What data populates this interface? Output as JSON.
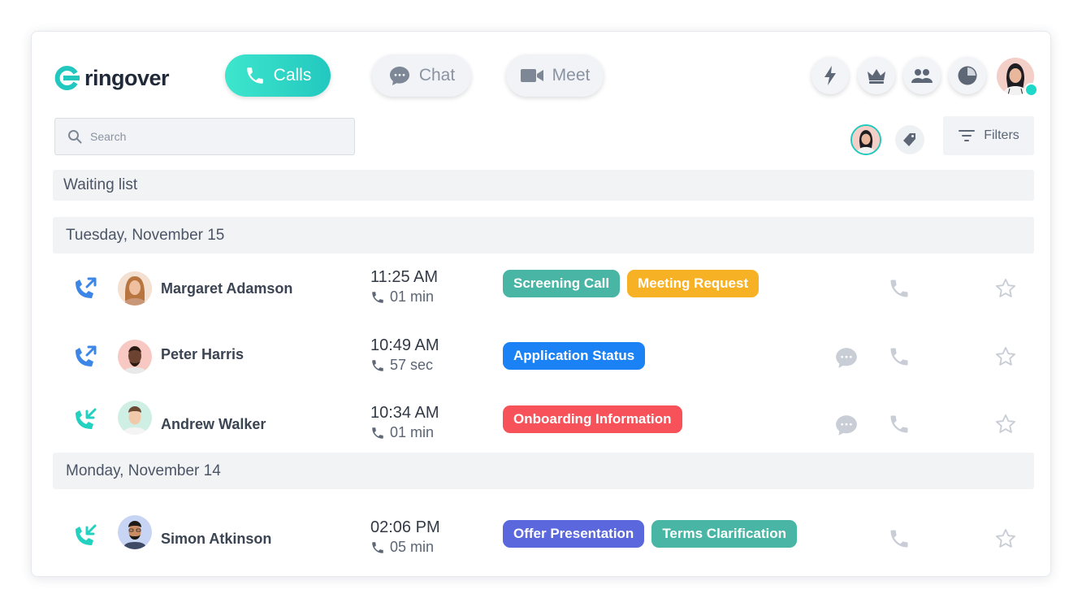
{
  "brand": {
    "name": "ringover",
    "accent": "#22c8be"
  },
  "nav": {
    "calls": "Calls",
    "chat": "Chat",
    "meet": "Meet"
  },
  "top_icons": [
    "bolt-icon",
    "crown-icon",
    "team-icon",
    "clock-icon"
  ],
  "search": {
    "placeholder": "Search",
    "value": ""
  },
  "filters_label": "Filters",
  "waiting_list": "Waiting list",
  "groups": [
    {
      "date": "Tuesday, November 15",
      "rows": [
        {
          "name": "Margaret Adamson",
          "direction": "outgoing",
          "time": "11:25 AM",
          "duration": "01 min",
          "tags": [
            {
              "label": "Screening Call",
              "color": "#49b5a5"
            },
            {
              "label": "Meeting Request",
              "color": "#f7b125"
            }
          ],
          "has_chat": false
        },
        {
          "name": "Peter Harris",
          "direction": "outgoing",
          "time": "10:49 AM",
          "duration": "57 sec",
          "tags": [
            {
              "label": "Application Status",
              "color": "#1a82f5"
            }
          ],
          "has_chat": true
        },
        {
          "name": "Andrew Walker",
          "direction": "incoming",
          "time": "10:34 AM",
          "duration": "01 min",
          "tags": [
            {
              "label": "Onboarding Information",
              "color": "#f7525a"
            }
          ],
          "has_chat": true
        }
      ]
    },
    {
      "date": "Monday, November 14",
      "rows": [
        {
          "name": "Simon Atkinson",
          "direction": "incoming",
          "time": "02:06 PM",
          "duration": "05 min",
          "tags": [
            {
              "label": "Offer Presentation",
              "color": "#5a67dd"
            },
            {
              "label": "Terms Clarification",
              "color": "#49b5a5"
            }
          ],
          "has_chat": false
        }
      ]
    }
  ]
}
